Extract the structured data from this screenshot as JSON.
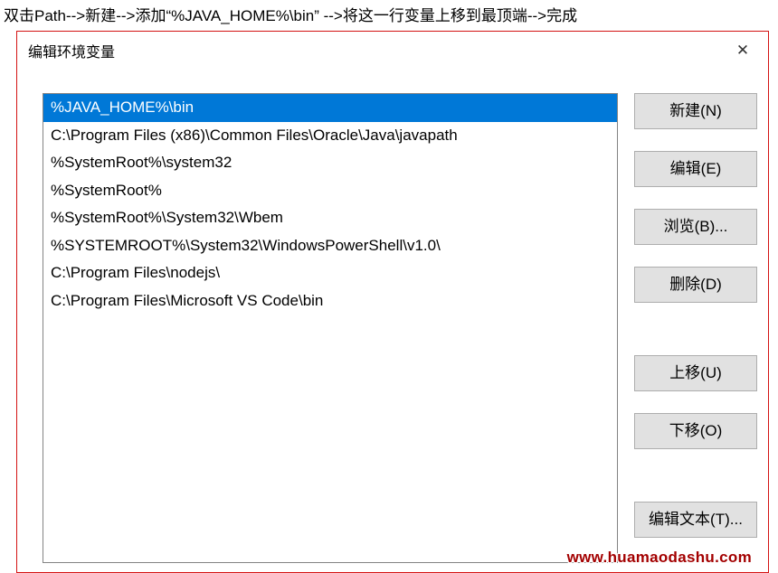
{
  "caption": "双击Path-->新建-->添加“%JAVA_HOME%\\bin” -->将这一行变量上移到最顶端-->完成",
  "window": {
    "title": "编辑环境变量"
  },
  "list": {
    "items": [
      "%JAVA_HOME%\\bin",
      "C:\\Program Files (x86)\\Common Files\\Oracle\\Java\\javapath",
      "%SystemRoot%\\system32",
      "%SystemRoot%",
      "%SystemRoot%\\System32\\Wbem",
      "%SYSTEMROOT%\\System32\\WindowsPowerShell\\v1.0\\",
      "C:\\Program Files\\nodejs\\",
      "C:\\Program Files\\Microsoft VS Code\\bin"
    ],
    "selected_index": 0
  },
  "buttons": {
    "new_label": "新建(N)",
    "edit_label": "编辑(E)",
    "browse_label": "浏览(B)...",
    "delete_label": "删除(D)",
    "move_up_label": "上移(U)",
    "move_down_label": "下移(O)",
    "edit_text_label": "编辑文本(T)..."
  },
  "watermark": "www.huamaodashu.com"
}
